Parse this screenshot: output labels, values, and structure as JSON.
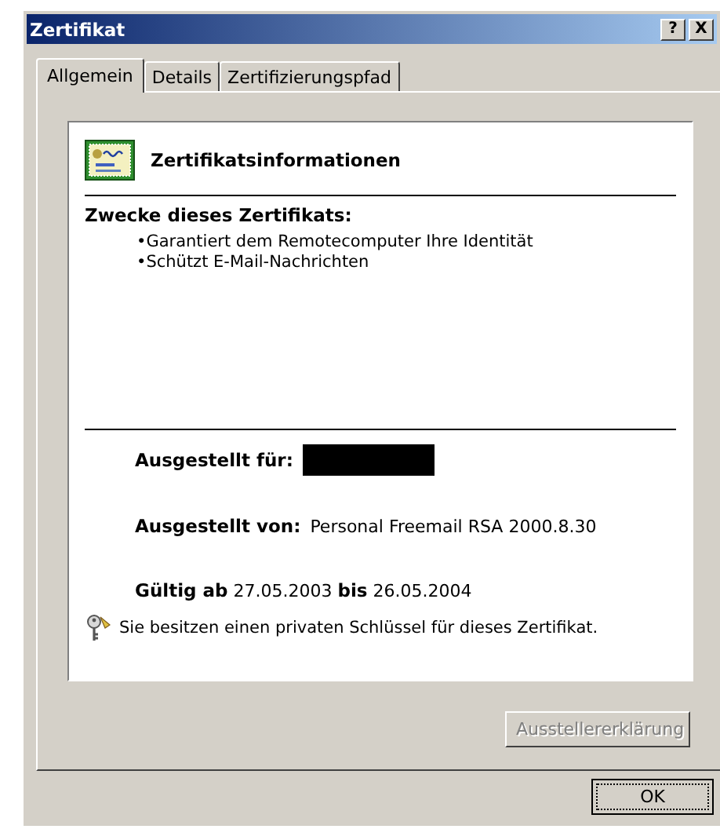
{
  "window": {
    "title": "Zertifikat",
    "help_button": "?",
    "close_button": "X"
  },
  "tabs": [
    {
      "label": "Allgemein",
      "selected": true
    },
    {
      "label": "Details",
      "selected": false
    },
    {
      "label": "Zertifizierungspfad",
      "selected": false
    }
  ],
  "info": {
    "heading": "Zertifikatsinformationen",
    "purposes_title": "Zwecke dieses Zertifikats:",
    "purposes": [
      "•Garantiert dem Remotecomputer Ihre Identität",
      "•Schützt E-Mail-Nachrichten"
    ],
    "issued_to_label": "Ausgestellt für:",
    "issued_to_redacted": true,
    "issued_by_label": "Ausgestellt von:",
    "issued_by": "Personal Freemail RSA 2000.8.30",
    "validity": "**Gültig ab** 27.05.2003 **bis** 26.05.2004",
    "private_key_note": "Sie besitzen einen privaten Schlüssel für dieses Zertifikat."
  },
  "buttons": [
    {
      "label": "Ausstellererklärung",
      "disabled": true,
      "kind": "issuer"
    },
    {
      "label": "OK",
      "disabled": false,
      "kind": "ok"
    }
  ]
}
